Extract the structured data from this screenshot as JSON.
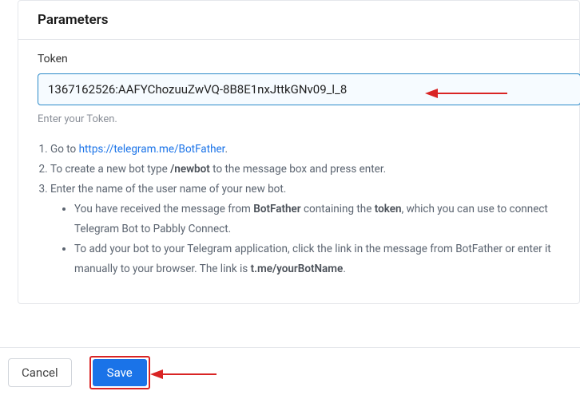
{
  "panel": {
    "title": "Parameters"
  },
  "token": {
    "label": "Token",
    "value": "1367162526:AAFYChozuuZwVQ-8B8E1nxJttkGNv09_l_8",
    "helper": "Enter your Token."
  },
  "instructions": {
    "step1_prefix": "Go to ",
    "step1_link": "https://telegram.me/BotFather",
    "step1_suffix": ".",
    "step2_prefix": "To create a new bot type ",
    "step2_bold": "/newbot",
    "step2_suffix": " to the message box and press enter.",
    "step3": "Enter the name of the user name of your new bot.",
    "bullet1_a": "You have received the message from ",
    "bullet1_b": "BotFather",
    "bullet1_c": " containing the ",
    "bullet1_d": "token",
    "bullet1_e": ", which you can use to connect Telegram Bot to Pabbly Connect.",
    "bullet2_a": "To add your bot to your Telegram application, click the link in the message from BotFather or enter it manually to your browser. The link is ",
    "bullet2_b": "t.me/yourBotName",
    "bullet2_c": "."
  },
  "buttons": {
    "cancel": "Cancel",
    "save": "Save"
  },
  "colors": {
    "arrow": "#d92424"
  }
}
